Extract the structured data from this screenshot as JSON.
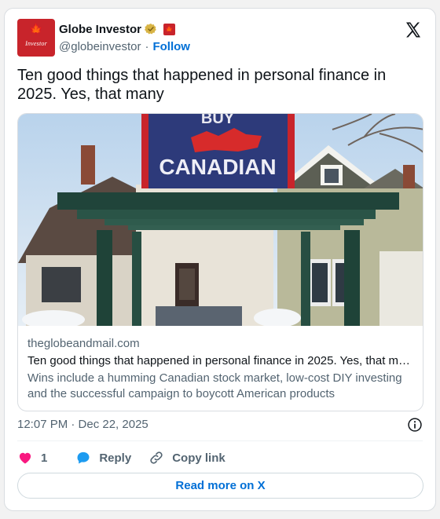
{
  "account": {
    "display_name": "Globe Investor",
    "handle": "@globeinvestor",
    "separator": "·",
    "follow_label": "Follow",
    "avatar_text": "Investor"
  },
  "tweet": {
    "text": "Ten good things that happened in personal finance in 2025. Yes, that many"
  },
  "link_card": {
    "domain": "theglobeandmail.com",
    "title": "Ten good things that happened in personal finance in 2025. Yes, that m…",
    "description": "Wins include a humming Canadian stock market, low-cost DIY investing and the successful campaign to boycott American products",
    "photo_sign_top": "BUY",
    "photo_sign_bottom": "CANADIAN"
  },
  "meta": {
    "timestamp": "12:07 PM · Dec 22, 2025"
  },
  "actions": {
    "like_count": "1",
    "reply_label": "Reply",
    "copy_link_label": "Copy link",
    "read_more_label": "Read more on X"
  },
  "colors": {
    "brand_red": "#c8242b",
    "link_blue": "#006fd6",
    "like_pink": "#f91880",
    "reply_blue": "#1d9bf0",
    "muted": "#536471"
  },
  "icons": [
    "maple-leaf-icon",
    "verified-gold-icon",
    "canada-flag-icon",
    "x-logo-icon",
    "info-icon",
    "heart-icon",
    "reply-icon",
    "link-icon"
  ]
}
